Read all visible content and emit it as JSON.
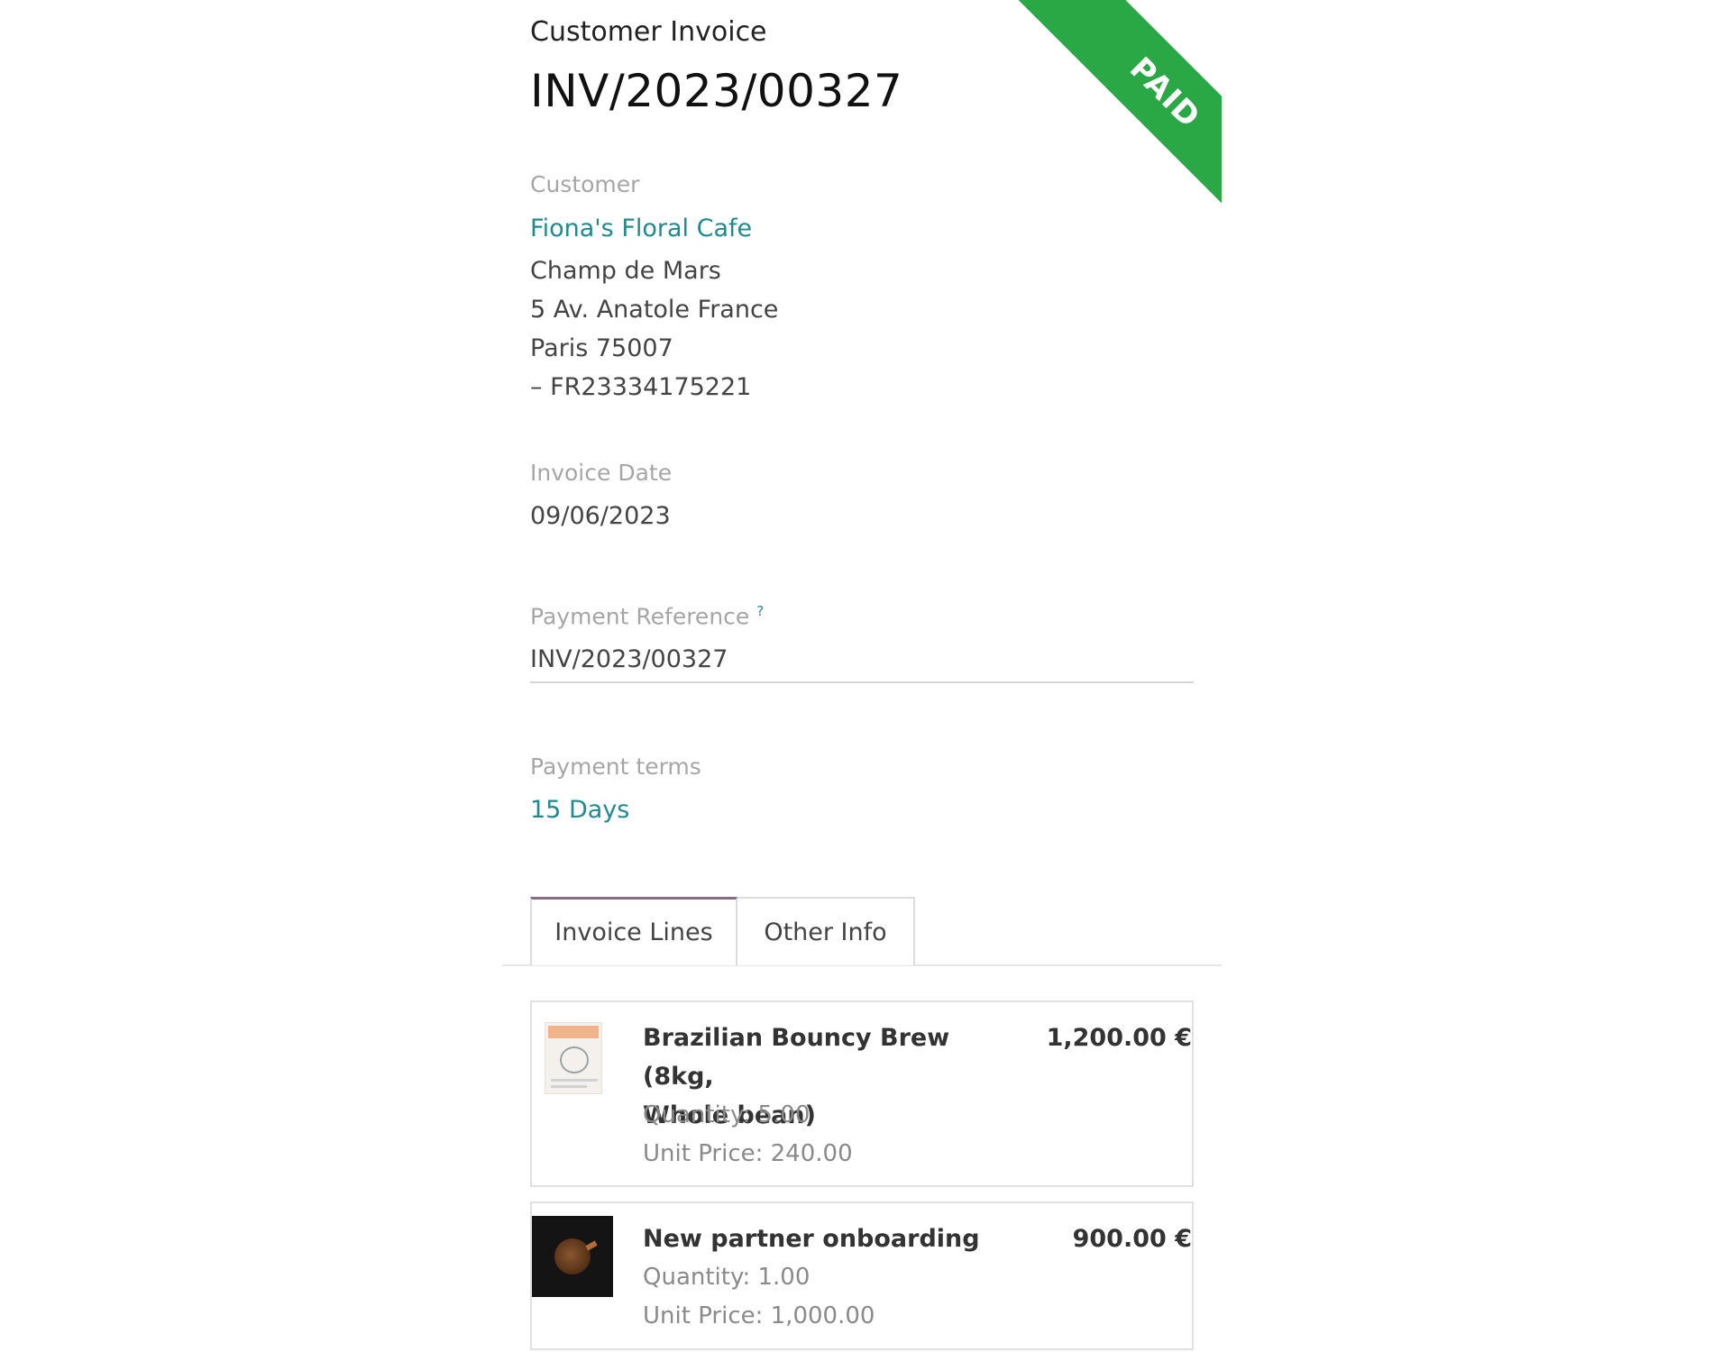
{
  "invoice": {
    "doc_type": "Customer Invoice",
    "number": "INV/2023/00327",
    "status_ribbon": "PAID",
    "ribbon_color": "#2aa845"
  },
  "customer": {
    "label": "Customer",
    "name": "Fiona's Floral Cafe",
    "address_lines": [
      "Champ de Mars",
      "5 Av. Anatole France",
      "Paris 75007",
      "– FR23334175221"
    ]
  },
  "invoice_date": {
    "label": "Invoice Date",
    "value": "09/06/2023"
  },
  "payment_reference": {
    "label": "Payment Reference",
    "help_mark": "?",
    "value": "INV/2023/00327"
  },
  "payment_terms": {
    "label": "Payment terms",
    "value": "15 Days"
  },
  "tabs": [
    {
      "label": "Invoice Lines",
      "active": true
    },
    {
      "label": "Other Info",
      "active": false
    }
  ],
  "lines": [
    {
      "product": "Brazilian Bouncy Brew (8kg, Whole bean)",
      "product_line1": "Brazilian Bouncy Brew (8kg,",
      "product_line2": "Whole bean)",
      "quantity": "Quantity: 5.00",
      "unit_price": "Unit Price: 240.00",
      "amount": "1,200.00 €",
      "thumb_icon": "coffee-bag-icon"
    },
    {
      "product": "New partner onboarding",
      "quantity": "Quantity: 1.00",
      "unit_price": "Unit Price: 1,000.00",
      "amount": "900.00 €",
      "thumb_icon": "coffee-beans-bowl-icon"
    }
  ],
  "colors": {
    "link": "#1f8a8f",
    "active_tab_accent": "#8a6c87"
  }
}
